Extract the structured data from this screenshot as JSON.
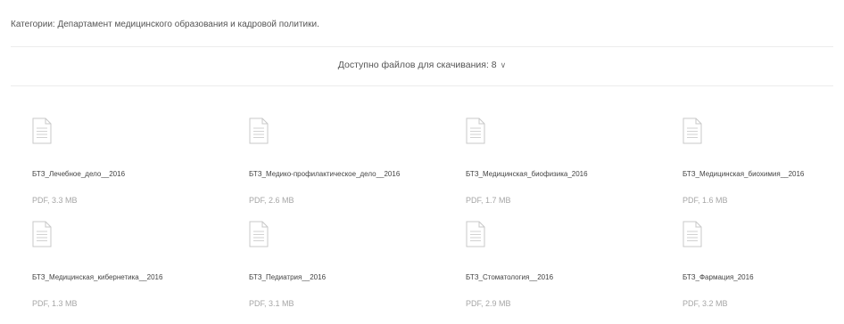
{
  "category": {
    "text": "Категории: Департамент медицинского образования и кадровой политики."
  },
  "downloads": {
    "label": "Доступно файлов для скачивания: 8",
    "chevron_icon": "chevron-down-icon"
  },
  "files": [
    {
      "name": "БТЗ_Лечебное_дело__2016",
      "meta": "PDF, 3.3 MB"
    },
    {
      "name": "БТЗ_Медико-профилактическое_дело__2016",
      "meta": "PDF, 2.6 MB"
    },
    {
      "name": "БТЗ_Медицинская_биофизика_2016",
      "meta": "PDF, 1.7 MB"
    },
    {
      "name": "БТЗ_Медицинская_биохимия__2016",
      "meta": "PDF, 1.6 MB"
    },
    {
      "name": "БТЗ_Медицинская_кибернетика__2016",
      "meta": "PDF, 1.3 MB"
    },
    {
      "name": "БТЗ_Педиатрия__2016",
      "meta": "PDF, 3.1 MB"
    },
    {
      "name": "БТЗ_Стоматология__2016",
      "meta": "PDF, 2.9 MB"
    },
    {
      "name": "БТЗ_Фармация_2016",
      "meta": "PDF, 3.2 MB"
    }
  ],
  "icons": {
    "file": "document-icon"
  },
  "colors": {
    "icon_stroke": "#c8c8c8",
    "meta_text": "#a6a6a6",
    "divider": "#ececec"
  }
}
